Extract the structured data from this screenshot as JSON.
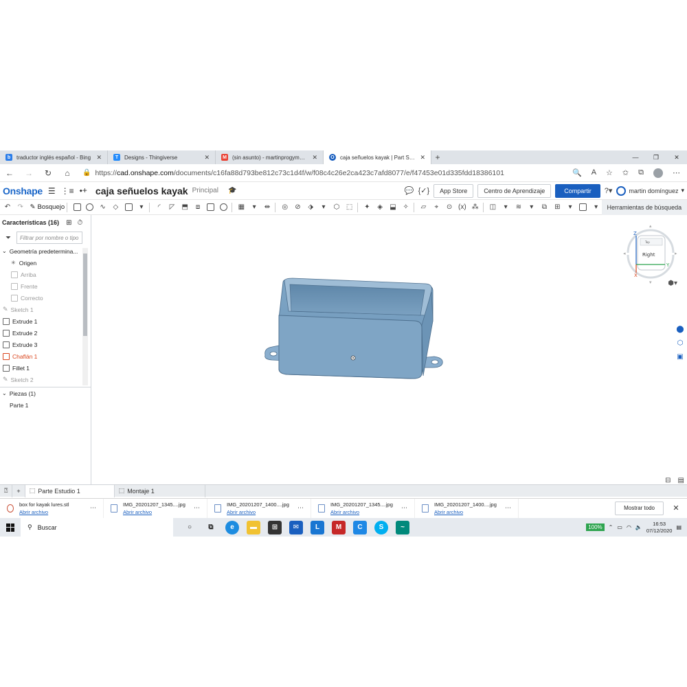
{
  "browser": {
    "tabs": [
      {
        "title": "traductor inglés español - Bing",
        "color": "#2b7de9",
        "glyph": "b"
      },
      {
        "title": "Designs - Thingiverse",
        "color": "#248bfb",
        "glyph": "T"
      },
      {
        "title": "(sin asunto) - martinprogym@gi",
        "color": "#ea4335",
        "glyph": "M"
      },
      {
        "title": "caja señuelos kayak | Part Studio",
        "color": "#1a5fbf",
        "glyph": "O"
      }
    ],
    "url_prefix": "https://",
    "url_host": "cad.onshape.com",
    "url_path": "/documents/c16fa88d793be812c73c1d4f/w/f08c4c26e2ca423c7afd8077/e/f47453e01d335fdd18386101"
  },
  "onshape": {
    "logo": "Onshape",
    "doc_title": "caja señuelos kayak",
    "branch": "Principal",
    "app_store": "App Store",
    "learning_center": "Centro de Aprendizaje",
    "share": "Compartir",
    "user": "martin domínguez"
  },
  "toolbar": {
    "sketch": "Bosquejo",
    "search_tools": "Herramientas de búsqueda"
  },
  "features": {
    "header": "Características (16)",
    "filter_placeholder": "Filtrar por nombre o tipo",
    "default_geometry": "Geometría predetermina...",
    "items": [
      {
        "label": "Origen",
        "state": "normal",
        "indent": 1
      },
      {
        "label": "Arriba",
        "state": "dim",
        "indent": 1
      },
      {
        "label": "Frente",
        "state": "dim",
        "indent": 1
      },
      {
        "label": "Correcto",
        "state": "dim",
        "indent": 1
      },
      {
        "label": "Sketch 1",
        "state": "dim",
        "indent": 0
      },
      {
        "label": "Extrude 1",
        "state": "normal",
        "indent": 0
      },
      {
        "label": "Extrude 2",
        "state": "normal",
        "indent": 0
      },
      {
        "label": "Extrude 3",
        "state": "normal",
        "indent": 0
      },
      {
        "label": "Chaflán 1",
        "state": "err",
        "indent": 0
      },
      {
        "label": "Fillet 1",
        "state": "normal",
        "indent": 0
      },
      {
        "label": "Sketch 2",
        "state": "dim",
        "indent": 0
      }
    ],
    "parts_header": "Piezas (1)",
    "part": "Parte 1"
  },
  "viewcube": {
    "face": "Right",
    "axis_z": "Z",
    "axis_y": "Y",
    "axis_x": "X",
    "top_face": "Top"
  },
  "bottom_tabs": {
    "part_studio": "Parte Estudio 1",
    "assembly": "Montaje 1"
  },
  "downloads": {
    "items": [
      {
        "name": "box for kayak lures.stl",
        "action": "Abrir archivo"
      },
      {
        "name": "IMG_20201207_1345....jpg",
        "action": "Abrir archivo"
      },
      {
        "name": "IMG_20201207_1400....jpg",
        "action": "Abrir archivo"
      },
      {
        "name": "IMG_20201207_1345....jpg",
        "action": "Abrir archivo"
      },
      {
        "name": "IMG_20201207_1400....jpg",
        "action": "Abrir archivo"
      }
    ],
    "show_all": "Mostrar todo"
  },
  "taskbar": {
    "search": "Buscar",
    "battery": "100%",
    "time": "16:53",
    "date": "07/12/2020"
  }
}
